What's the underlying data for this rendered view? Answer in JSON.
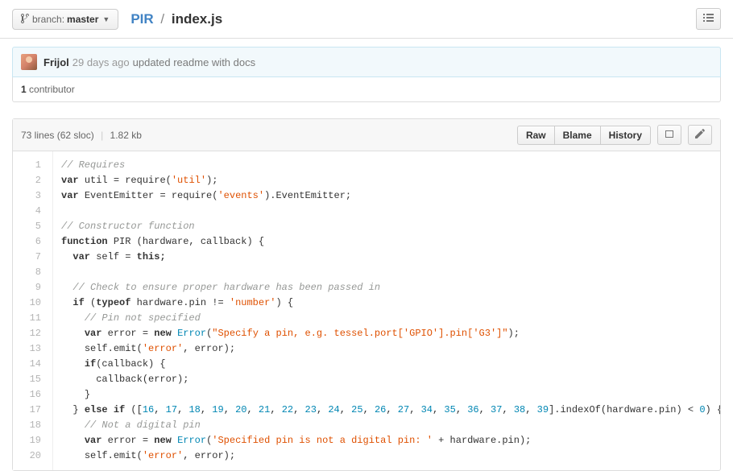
{
  "branch": {
    "label": "branch:",
    "name": "master"
  },
  "breadcrumb": {
    "repo": "PIR",
    "sep": "/",
    "file": "index.js"
  },
  "commit": {
    "author": "Frijol",
    "time": "29 days ago",
    "message": "updated readme with docs"
  },
  "contributors": {
    "count": "1",
    "label": "contributor"
  },
  "file_meta": {
    "lines": "73 lines (62 sloc)",
    "size": "1.82 kb"
  },
  "actions": {
    "raw": "Raw",
    "blame": "Blame",
    "history": "History"
  },
  "code": {
    "line_count": 20,
    "r": {
      "c_req": "// Requires",
      "kvar": "var",
      "util": "util",
      "eq": "=",
      "req": "require",
      "s_util": "'util'",
      "ee": "EventEmitter",
      "s_events": "'events'",
      "dot_ee": ".EventEmitter;",
      "c_ctor": "// Constructor function",
      "kfn": "function",
      "pir": "PIR",
      "args_hw_cb": "(hardware, callback) {",
      "self": "self",
      "this": "this;",
      "c_check": "// Check to ensure proper hardware has been passed in",
      "kif": "if",
      "ktypeof": "typeof",
      "hwpin": "hardware.pin",
      "neq": "!=",
      "s_number": "'number'",
      "c_pinnot": "// Pin not specified",
      "error": "error",
      "knew": "new",
      "Error": "Error",
      "s_specify": "\"Specify a pin, e.g. tessel.port['GPIO'].pin['G3']\"",
      "selfemit": "self.emit(",
      "s_error": "'error'",
      "comma_err": ", error);",
      "ifcb": "(callback) {",
      "cb_err": "callback(error);",
      "close": "}",
      "kelse": "else if",
      "arr_nums": "16, 17, 18, 19, 20, 21, 22, 23, 24, 25, 26, 27, 34, 35, 36, 37, 38, 39",
      "idxof": "].indexOf(hardware.pin)",
      "lt": "<",
      "zero": "0",
      "c_notdig": "// Not a digital pin",
      "s_notdig": "'Specified pin is not a digital pin: '",
      "plus_hwpin": "+ hardware.pin);"
    }
  }
}
